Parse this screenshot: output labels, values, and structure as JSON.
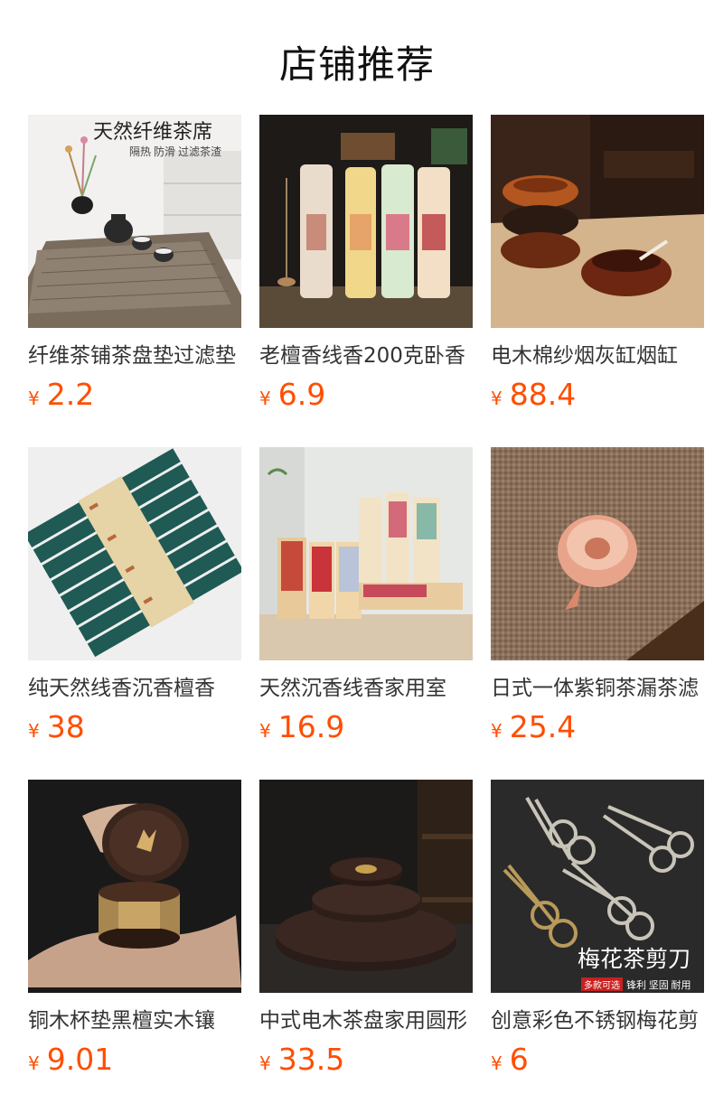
{
  "section_title": "店铺推荐",
  "currency_symbol": "¥",
  "products": [
    {
      "name": "纤维茶铺茶盘垫过滤垫",
      "price": "2.2",
      "image_caption": "天然纤维茶席",
      "image_subcaption": "隔热 防滑 过滤茶渣"
    },
    {
      "name": "老檀香线香200克卧香",
      "price": "6.9"
    },
    {
      "name": "电木棉纱烟灰缸烟缸",
      "price": "88.4"
    },
    {
      "name": "纯天然线香沉香檀香",
      "price": "38"
    },
    {
      "name": "天然沉香线香家用室",
      "price": "16.9"
    },
    {
      "name": "日式一体紫铜茶漏茶滤",
      "price": "25.4"
    },
    {
      "name": "铜木杯垫黑檀实木镶",
      "price": "9.01"
    },
    {
      "name": "中式电木茶盘家用圆形",
      "price": "33.5"
    },
    {
      "name": "创意彩色不锈钢梅花剪",
      "price": "6",
      "image_caption": "梅花茶剪刀",
      "image_badge": "多款可选",
      "image_subcaption": "锋利 坚固 耐用"
    }
  ]
}
